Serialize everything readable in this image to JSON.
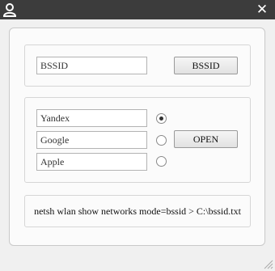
{
  "window": {
    "icon": "user-icon",
    "close_label": "✕"
  },
  "bssid": {
    "input_value": "BSSID",
    "button_label": "BSSID"
  },
  "search": {
    "options": [
      {
        "value": "Yandex",
        "selected": true
      },
      {
        "value": "Google",
        "selected": false
      },
      {
        "value": "Apple",
        "selected": false
      }
    ],
    "open_label": "OPEN"
  },
  "command": {
    "text": "netsh wlan show networks mode=bssid > C:\\bssid.txt"
  }
}
